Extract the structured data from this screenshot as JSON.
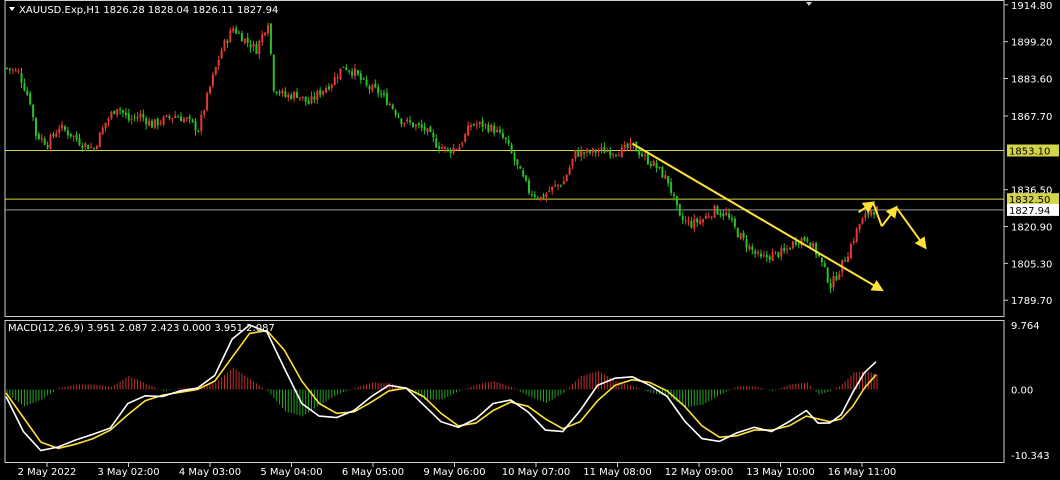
{
  "header": {
    "symbol_line": "XAUUSD.Exp,H1  1826.28 1828.04 1826.11 1827.94",
    "macd_line": "MACD(12,26,9) 3.951 2.087 2.423 0.000 3.951 2.087"
  },
  "colors": {
    "background": "#000000",
    "bull": "#e53935",
    "bear": "#28c228",
    "level_line": "#d4d44a",
    "trend_arrow": "#ffe135",
    "macd_main": "#ffffff",
    "macd_signal": "#ffe135",
    "axis_text": "#ffffff",
    "price_tag_text": "#000000"
  },
  "chart_data": [
    {
      "type": "candlestick",
      "series_name": "XAUUSD.Exp,H1",
      "ylim": [
        1783,
        1916
      ],
      "y_ticks": [
        "1914.80",
        "1899.20",
        "1883.60",
        "1867.70",
        "1836.50",
        "1820.90",
        "1805.30",
        "1789.70"
      ],
      "price_tags": [
        {
          "value": 1853.1,
          "label": "1853.10",
          "line": true
        },
        {
          "value": 1832.5,
          "label": "1832.50",
          "line": true
        },
        {
          "value": 1827.94,
          "label": "1827.94",
          "line": true
        }
      ],
      "x_labels": [
        "2 May 2022",
        "3 May 02:00",
        "4 May 03:00",
        "5 May 04:00",
        "6 May 05:00",
        "9 May 06:00",
        "10 May 07:00",
        "11 May 08:00",
        "12 May 09:00",
        "13 May 10:00",
        "16 May 11:00"
      ],
      "anchors": [
        [
          0,
          1888
        ],
        [
          4,
          1886
        ],
        [
          8,
          1874
        ],
        [
          10,
          1860
        ],
        [
          14,
          1856
        ],
        [
          18,
          1863
        ],
        [
          22,
          1860
        ],
        [
          26,
          1856
        ],
        [
          30,
          1854
        ],
        [
          34,
          1865
        ],
        [
          38,
          1872
        ],
        [
          42,
          1866
        ],
        [
          46,
          1868
        ],
        [
          50,
          1864
        ],
        [
          54,
          1866
        ],
        [
          58,
          1868
        ],
        [
          62,
          1866
        ],
        [
          66,
          1862
        ],
        [
          70,
          1880
        ],
        [
          74,
          1896
        ],
        [
          78,
          1905
        ],
        [
          82,
          1900
        ],
        [
          86,
          1896
        ],
        [
          90,
          1908
        ],
        [
          92,
          1880
        ],
        [
          96,
          1876
        ],
        [
          100,
          1877
        ],
        [
          104,
          1873
        ],
        [
          108,
          1878
        ],
        [
          112,
          1882
        ],
        [
          116,
          1889
        ],
        [
          120,
          1886
        ],
        [
          124,
          1880
        ],
        [
          128,
          1878
        ],
        [
          132,
          1873
        ],
        [
          136,
          1866
        ],
        [
          140,
          1864
        ],
        [
          144,
          1862
        ],
        [
          148,
          1856
        ],
        [
          152,
          1853
        ],
        [
          156,
          1855
        ],
        [
          160,
          1864
        ],
        [
          164,
          1864
        ],
        [
          168,
          1862
        ],
        [
          172,
          1857
        ],
        [
          176,
          1846
        ],
        [
          180,
          1836
        ],
        [
          184,
          1833
        ],
        [
          188,
          1837
        ],
        [
          192,
          1840
        ],
        [
          196,
          1852
        ],
        [
          200,
          1852
        ],
        [
          204,
          1853
        ],
        [
          208,
          1853
        ],
        [
          212,
          1853
        ],
        [
          216,
          1855
        ],
        [
          220,
          1850
        ],
        [
          224,
          1846
        ],
        [
          228,
          1840
        ],
        [
          232,
          1824
        ],
        [
          236,
          1822
        ],
        [
          240,
          1824
        ],
        [
          244,
          1828
        ],
        [
          248,
          1826
        ],
        [
          252,
          1818
        ],
        [
          256,
          1812
        ],
        [
          260,
          1807
        ],
        [
          264,
          1809
        ],
        [
          268,
          1810
        ],
        [
          272,
          1815
        ],
        [
          276,
          1816
        ],
        [
          280,
          1808
        ],
        [
          284,
          1796
        ],
        [
          286,
          1800
        ],
        [
          290,
          1810
        ],
        [
          294,
          1822
        ],
        [
          298,
          1828
        ],
        [
          300,
          1828
        ]
      ],
      "trend_arrows": [
        {
          "from": {
            "bar": 216,
            "price": 1856
          },
          "to": {
            "bar": 302,
            "price": 1794
          }
        },
        {
          "from": {
            "bar": 294,
            "price": 1827
          },
          "to": {
            "bar": 299,
            "price": 1831
          }
        },
        {
          "from": {
            "bar": 299,
            "price": 1831
          },
          "to": {
            "bar": 302,
            "price": 1821
          }
        },
        {
          "from": {
            "bar": 302,
            "price": 1821
          },
          "to": {
            "bar": 307,
            "price": 1829
          }
        },
        {
          "from": {
            "bar": 307,
            "price": 1829
          },
          "to": {
            "bar": 317,
            "price": 1812
          }
        }
      ]
    },
    {
      "type": "line",
      "title": "MACD(12,26,9) 3.951 2.087 2.423 0.000 3.951 2.087",
      "ylim": [
        -10.343,
        9.764
      ],
      "y_ticks": [
        "9.764",
        "0.00",
        "-10.343"
      ],
      "series": [
        {
          "name": "MACD",
          "style": "white line",
          "points": [
            [
              0,
              -1
            ],
            [
              6,
              -6
            ],
            [
              12,
              -8.7
            ],
            [
              18,
              -8.2
            ],
            [
              24,
              -7.2
            ],
            [
              30,
              -6.4
            ],
            [
              36,
              -5.5
            ],
            [
              42,
              -2
            ],
            [
              48,
              -0.9
            ],
            [
              54,
              -1
            ],
            [
              60,
              -0.2
            ],
            [
              66,
              0.2
            ],
            [
              72,
              2
            ],
            [
              78,
              7.2
            ],
            [
              84,
              9.2
            ],
            [
              90,
              8.2
            ],
            [
              96,
              3
            ],
            [
              102,
              -2
            ],
            [
              108,
              -3.8
            ],
            [
              114,
              -4
            ],
            [
              120,
              -3
            ],
            [
              126,
              -1
            ],
            [
              132,
              0.6
            ],
            [
              138,
              0.2
            ],
            [
              144,
              -2.2
            ],
            [
              150,
              -4.6
            ],
            [
              156,
              -5.4
            ],
            [
              162,
              -4.2
            ],
            [
              168,
              -2
            ],
            [
              174,
              -1.5
            ],
            [
              180,
              -3.2
            ],
            [
              186,
              -5.8
            ],
            [
              192,
              -6
            ],
            [
              198,
              -3
            ],
            [
              204,
              0.6
            ],
            [
              210,
              1.6
            ],
            [
              216,
              1.8
            ],
            [
              222,
              0.6
            ],
            [
              228,
              -1
            ],
            [
              234,
              -4.5
            ],
            [
              240,
              -7
            ],
            [
              246,
              -7.4
            ],
            [
              252,
              -6.2
            ],
            [
              258,
              -5.4
            ],
            [
              264,
              -6
            ],
            [
              270,
              -4.6
            ],
            [
              276,
              -3
            ],
            [
              280,
              -4.8
            ],
            [
              284,
              -4.8
            ],
            [
              288,
              -3.6
            ],
            [
              292,
              -0.4
            ],
            [
              296,
              2.4
            ],
            [
              300,
              3.95
            ]
          ]
        },
        {
          "name": "Signal",
          "style": "yellow line",
          "points": [
            [
              0,
              -0.5
            ],
            [
              6,
              -4
            ],
            [
              12,
              -7.5
            ],
            [
              18,
              -8.4
            ],
            [
              24,
              -7.8
            ],
            [
              30,
              -7
            ],
            [
              36,
              -5.8
            ],
            [
              42,
              -3.6
            ],
            [
              48,
              -1.6
            ],
            [
              54,
              -0.8
            ],
            [
              60,
              -0.4
            ],
            [
              66,
              0
            ],
            [
              72,
              1.2
            ],
            [
              78,
              4.6
            ],
            [
              84,
              8
            ],
            [
              90,
              8.4
            ],
            [
              96,
              5.6
            ],
            [
              102,
              1.2
            ],
            [
              108,
              -2
            ],
            [
              114,
              -3.4
            ],
            [
              120,
              -3.2
            ],
            [
              126,
              -1.8
            ],
            [
              132,
              -0.2
            ],
            [
              138,
              0.2
            ],
            [
              144,
              -1
            ],
            [
              150,
              -3.4
            ],
            [
              156,
              -5.2
            ],
            [
              162,
              -4.8
            ],
            [
              168,
              -3
            ],
            [
              174,
              -1.8
            ],
            [
              180,
              -2.4
            ],
            [
              186,
              -4.2
            ],
            [
              192,
              -5.6
            ],
            [
              198,
              -4.6
            ],
            [
              204,
              -1.6
            ],
            [
              210,
              0.6
            ],
            [
              216,
              1.4
            ],
            [
              222,
              1
            ],
            [
              228,
              -0.2
            ],
            [
              234,
              -2.4
            ],
            [
              240,
              -5.2
            ],
            [
              246,
              -6.8
            ],
            [
              252,
              -6.6
            ],
            [
              258,
              -5.8
            ],
            [
              264,
              -5.8
            ],
            [
              270,
              -5.2
            ],
            [
              276,
              -3.8
            ],
            [
              280,
              -4.2
            ],
            [
              284,
              -4.6
            ],
            [
              288,
              -4.2
            ],
            [
              292,
              -2.4
            ],
            [
              296,
              0.2
            ],
            [
              300,
              2.09
            ]
          ]
        }
      ]
    }
  ]
}
